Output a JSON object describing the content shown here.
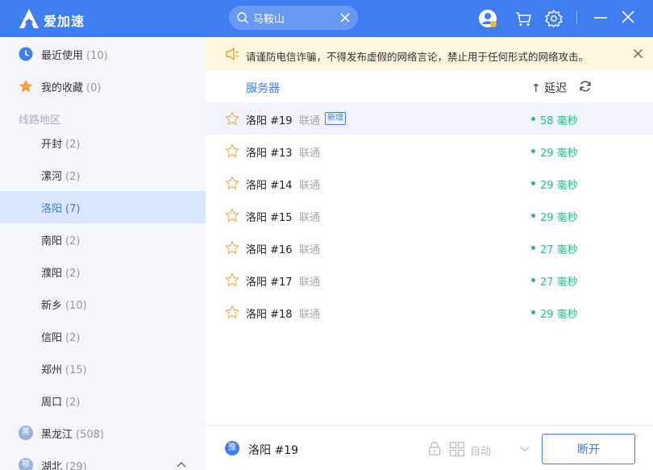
{
  "app": {
    "name": "爱加速"
  },
  "search": {
    "value": "马鞍山",
    "placeholder": ""
  },
  "sidebar": {
    "recent": {
      "label": "最近使用",
      "count": "(10)"
    },
    "favorites": {
      "label": "我的收藏",
      "count": "(0)"
    },
    "section_label": "线路地区",
    "regions": [
      {
        "label": "开封",
        "count": "(2)"
      },
      {
        "label": "漯河",
        "count": "(2)"
      },
      {
        "label": "洛阳",
        "count": "(7)"
      },
      {
        "label": "南阳",
        "count": "(2)"
      },
      {
        "label": "濮阳",
        "count": "(2)"
      },
      {
        "label": "新乡",
        "count": "(10)"
      },
      {
        "label": "信阳",
        "count": "(2)"
      },
      {
        "label": "郑州",
        "count": "(15)"
      },
      {
        "label": "周口",
        "count": "(2)"
      }
    ],
    "provinces": [
      {
        "badge": "黑",
        "label": "黑龙江",
        "count": "(508)"
      },
      {
        "badge": "鄂",
        "label": "湖北",
        "count": "(29)"
      }
    ]
  },
  "notice": {
    "text": "请谨防电信诈骗，不得发布虚假的网络言论，禁止用于任何形式的网络攻击。"
  },
  "list_header": {
    "server": "服务器",
    "latency": "↑ 延迟"
  },
  "servers": [
    {
      "name": "洛阳 #19",
      "line": "联通",
      "tag": "新增",
      "latency": "58 毫秒"
    },
    {
      "name": "洛阳 #13",
      "line": "联通",
      "tag": "",
      "latency": "29 毫秒"
    },
    {
      "name": "洛阳 #14",
      "line": "联通",
      "tag": "",
      "latency": "29 毫秒"
    },
    {
      "name": "洛阳 #15",
      "line": "联通",
      "tag": "",
      "latency": "29 毫秒"
    },
    {
      "name": "洛阳 #16",
      "line": "联通",
      "tag": "",
      "latency": "27 毫秒"
    },
    {
      "name": "洛阳 #17",
      "line": "联通",
      "tag": "",
      "latency": "27 毫秒"
    },
    {
      "name": "洛阳 #18",
      "line": "联通",
      "tag": "",
      "latency": "29 毫秒"
    }
  ],
  "bottom": {
    "badge": "豫",
    "current_server": "洛阳 #19",
    "mode": "自动",
    "disconnect_label": "断开"
  },
  "colors": {
    "accent": "#3f7df3",
    "latency_good": "#26c281",
    "notice_bg": "#fdf5de"
  },
  "icons": [
    "logo-icon",
    "search-icon",
    "clear-icon",
    "avatar-icon",
    "cart-icon",
    "gear-icon",
    "minimize-icon",
    "close-icon",
    "clock-icon",
    "star-icon",
    "speaker-icon",
    "refresh-icon",
    "lock-icon",
    "grid-icon",
    "chevron-down-icon",
    "chevron-up-icon"
  ]
}
